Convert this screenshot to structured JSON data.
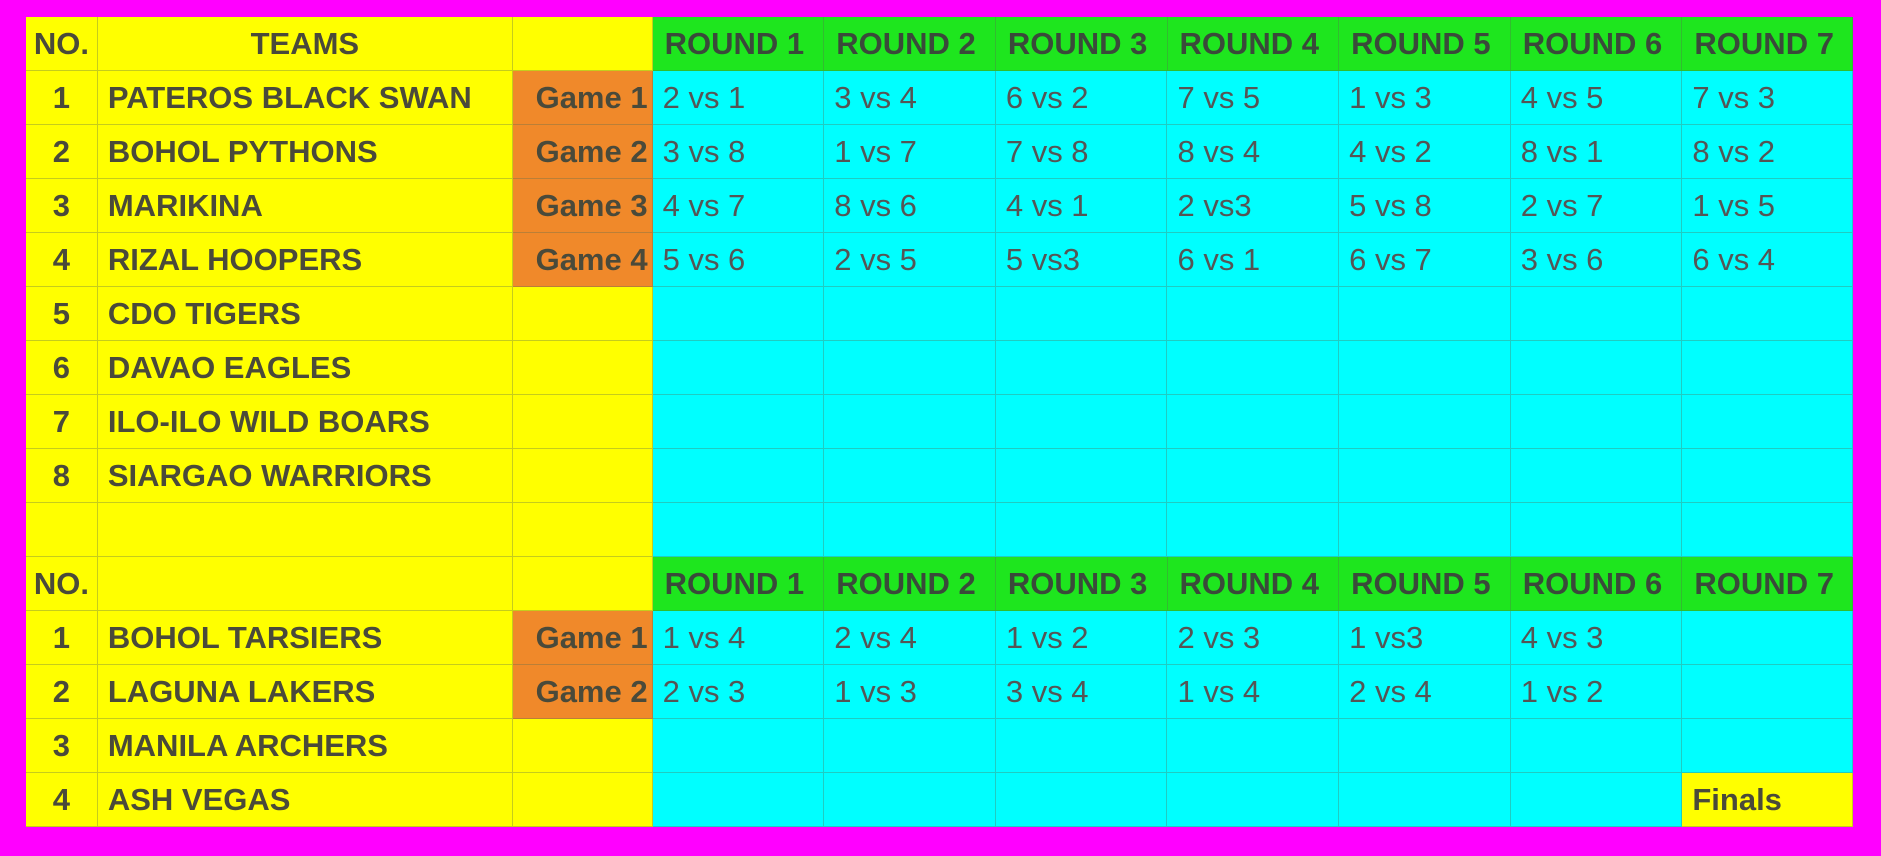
{
  "section1": {
    "header": {
      "no": "NO.",
      "teams": "TEAMS",
      "game": ""
    },
    "rounds": [
      "ROUND 1",
      "ROUND 2",
      "ROUND 3",
      "ROUND 4",
      "ROUND 5",
      "ROUND 6",
      "ROUND 7"
    ],
    "rows": [
      {
        "no": "1",
        "team": "PATEROS BLACK SWAN",
        "game": "Game 1",
        "matches": [
          "2 vs 1",
          "3 vs 4",
          "6 vs 2",
          "7 vs 5",
          "1 vs 3",
          "4 vs 5",
          "7 vs 3"
        ]
      },
      {
        "no": "2",
        "team": "BOHOL PYTHONS",
        "game": "Game 2",
        "matches": [
          "3 vs 8",
          "1 vs 7",
          "7 vs 8",
          "8 vs 4",
          "4 vs 2",
          "8 vs 1",
          "8 vs 2"
        ]
      },
      {
        "no": "3",
        "team": "MARIKINA",
        "game": "Game 3",
        "matches": [
          "4 vs 7",
          "8 vs 6",
          "4 vs 1",
          "2 vs3",
          "5 vs 8",
          "2 vs 7",
          "1 vs 5"
        ]
      },
      {
        "no": "4",
        "team": "RIZAL HOOPERS",
        "game": "Game 4",
        "matches": [
          "5 vs 6",
          "2 vs 5",
          "5 vs3",
          "6 vs 1",
          "6 vs 7",
          "3 vs 6",
          "6 vs 4"
        ]
      },
      {
        "no": "5",
        "team": "CDO TIGERS",
        "game": "",
        "matches": [
          "",
          "",
          "",
          "",
          "",
          "",
          ""
        ]
      },
      {
        "no": "6",
        "team": "DAVAO EAGLES",
        "game": "",
        "matches": [
          "",
          "",
          "",
          "",
          "",
          "",
          ""
        ]
      },
      {
        "no": "7",
        "team": "ILO-ILO  WILD BOARS",
        "game": "",
        "matches": [
          "",
          "",
          "",
          "",
          "",
          "",
          ""
        ]
      },
      {
        "no": "8",
        "team": "SIARGAO WARRIORS",
        "game": "",
        "matches": [
          "",
          "",
          "",
          "",
          "",
          "",
          ""
        ]
      },
      {
        "no": "",
        "team": "",
        "game": "",
        "matches": [
          "",
          "",
          "",
          "",
          "",
          "",
          ""
        ]
      }
    ]
  },
  "section2": {
    "header": {
      "no": "NO.",
      "teams": "",
      "game": ""
    },
    "rounds": [
      "ROUND 1",
      "ROUND 2",
      "ROUND 3",
      "ROUND 4",
      "ROUND 5",
      "ROUND 6",
      "ROUND 7"
    ],
    "rows": [
      {
        "no": "1",
        "team": " BOHOL TARSIERS",
        "game": "Game 1",
        "matches": [
          "1 vs 4",
          "2 vs 4",
          "1 vs 2",
          "2 vs 3",
          "1 vs3",
          "4 vs 3",
          ""
        ]
      },
      {
        "no": "2",
        "team": "LAGUNA LAKERS",
        "game": "Game 2",
        "matches": [
          "2 vs 3",
          "1 vs 3",
          "3 vs 4",
          "1 vs 4",
          "2 vs 4",
          "1 vs 2",
          ""
        ]
      },
      {
        "no": "3",
        "team": "MANILA ARCHERS",
        "game": "",
        "matches": [
          "",
          "",
          "",
          "",
          "",
          "",
          ""
        ]
      },
      {
        "no": "4",
        "team": "ASH VEGAS",
        "game": "",
        "matches": [
          "",
          "",
          "",
          "",
          "",
          "",
          "Finals"
        ]
      }
    ]
  },
  "colors": {
    "background": "#ff00ff",
    "team_column": "#ffff00",
    "game_label": "#f0892a",
    "match_cells": "#00ffff",
    "round_header": "#1ee61e"
  }
}
